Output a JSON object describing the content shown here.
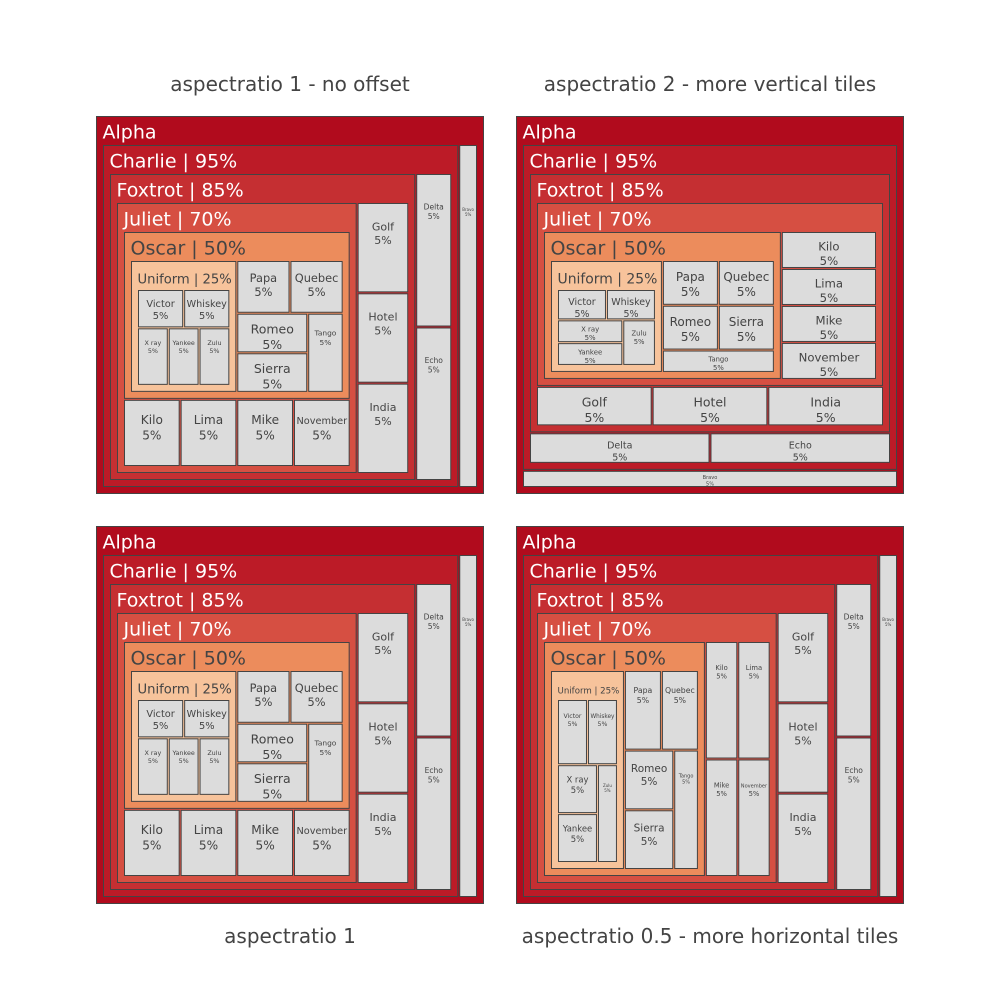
{
  "colors": {
    "Alpha": "#b10b1d",
    "Charlie": "#bc1b27",
    "Foxtrot": "#c52f32",
    "Juliet": "#d64f42",
    "Oscar": "#ec8c5c",
    "Uniform": "#f7c39b",
    "leaf": "#dcdcdc",
    "stroke": "#444444",
    "darkText": "#444444",
    "lightText": "#ffffff"
  },
  "panels": [
    {
      "title": "aspectratio 1 - no offset"
    },
    {
      "title": "aspectratio 2 - more vertical tiles"
    },
    {
      "title": "aspectratio 1"
    },
    {
      "title": "aspectratio 0.5 - more horizontal tiles"
    }
  ],
  "chart_data": [
    {
      "type": "treemap",
      "title": "aspectratio 1 - no offset",
      "nodes": [
        {
          "id": "Alpha",
          "label": "Alpha",
          "parent": "",
          "value": 100
        },
        {
          "id": "Bravo",
          "label": "Bravo",
          "parent": "Alpha",
          "value": 5,
          "text": "5%"
        },
        {
          "id": "Charlie",
          "label": "Charlie",
          "parent": "Alpha",
          "value": 95,
          "text": "95%"
        },
        {
          "id": "Delta",
          "label": "Delta",
          "parent": "Charlie",
          "value": 5,
          "text": "5%"
        },
        {
          "id": "Echo",
          "label": "Echo",
          "parent": "Charlie",
          "value": 5,
          "text": "5%"
        },
        {
          "id": "Foxtrot",
          "label": "Foxtrot",
          "parent": "Charlie",
          "value": 85,
          "text": "85%"
        },
        {
          "id": "Golf",
          "label": "Golf",
          "parent": "Foxtrot",
          "value": 5,
          "text": "5%"
        },
        {
          "id": "Hotel",
          "label": "Hotel",
          "parent": "Foxtrot",
          "value": 5,
          "text": "5%"
        },
        {
          "id": "India",
          "label": "India",
          "parent": "Foxtrot",
          "value": 5,
          "text": "5%"
        },
        {
          "id": "Juliet",
          "label": "Juliet",
          "parent": "Foxtrot",
          "value": 70,
          "text": "70%"
        },
        {
          "id": "Kilo",
          "label": "Kilo",
          "parent": "Juliet",
          "value": 5,
          "text": "5%"
        },
        {
          "id": "Lima",
          "label": "Lima",
          "parent": "Juliet",
          "value": 5,
          "text": "5%"
        },
        {
          "id": "Mike",
          "label": "Mike",
          "parent": "Juliet",
          "value": 5,
          "text": "5%"
        },
        {
          "id": "November",
          "label": "November",
          "parent": "Juliet",
          "value": 5,
          "text": "5%"
        },
        {
          "id": "Oscar",
          "label": "Oscar",
          "parent": "Juliet",
          "value": 50,
          "text": "50%"
        },
        {
          "id": "Papa",
          "label": "Papa",
          "parent": "Oscar",
          "value": 5,
          "text": "5%"
        },
        {
          "id": "Quebec",
          "label": "Quebec",
          "parent": "Oscar",
          "value": 5,
          "text": "5%"
        },
        {
          "id": "Romeo",
          "label": "Romeo",
          "parent": "Oscar",
          "value": 5,
          "text": "5%"
        },
        {
          "id": "Sierra",
          "label": "Sierra",
          "parent": "Oscar",
          "value": 5,
          "text": "5%"
        },
        {
          "id": "Tango",
          "label": "Tango",
          "parent": "Oscar",
          "value": 5,
          "text": "5%"
        },
        {
          "id": "Uniform",
          "label": "Uniform",
          "parent": "Oscar",
          "value": 25,
          "text": "25%"
        },
        {
          "id": "Victor",
          "label": "Victor",
          "parent": "Uniform",
          "value": 5,
          "text": "5%"
        },
        {
          "id": "Whiskey",
          "label": "Whiskey",
          "parent": "Uniform",
          "value": 5,
          "text": "5%"
        },
        {
          "id": "X ray",
          "label": "X ray",
          "parent": "Uniform",
          "value": 5,
          "text": "5%"
        },
        {
          "id": "Yankee",
          "label": "Yankee",
          "parent": "Uniform",
          "value": 5,
          "text": "5%"
        },
        {
          "id": "Zulu",
          "label": "Zulu",
          "parent": "Uniform",
          "value": 5,
          "text": "5%"
        }
      ]
    },
    {
      "type": "treemap",
      "title": "aspectratio 2 - more vertical tiles",
      "nodes": [
        {
          "id": "Alpha",
          "label": "Alpha",
          "parent": "",
          "value": 100
        },
        {
          "id": "Bravo",
          "label": "Bravo",
          "parent": "Alpha",
          "value": 5,
          "text": "5%"
        },
        {
          "id": "Charlie",
          "label": "Charlie",
          "parent": "Alpha",
          "value": 95,
          "text": "95%"
        },
        {
          "id": "Delta",
          "label": "Delta",
          "parent": "Charlie",
          "value": 5,
          "text": "5%"
        },
        {
          "id": "Echo",
          "label": "Echo",
          "parent": "Charlie",
          "value": 5,
          "text": "5%"
        },
        {
          "id": "Foxtrot",
          "label": "Foxtrot",
          "parent": "Charlie",
          "value": 85,
          "text": "85%"
        },
        {
          "id": "Golf",
          "label": "Golf",
          "parent": "Foxtrot",
          "value": 5,
          "text": "5%"
        },
        {
          "id": "Hotel",
          "label": "Hotel",
          "parent": "Foxtrot",
          "value": 5,
          "text": "5%"
        },
        {
          "id": "India",
          "label": "India",
          "parent": "Foxtrot",
          "value": 5,
          "text": "5%"
        },
        {
          "id": "Juliet",
          "label": "Juliet",
          "parent": "Foxtrot",
          "value": 70,
          "text": "70%"
        },
        {
          "id": "Kilo",
          "label": "Kilo",
          "parent": "Juliet",
          "value": 5,
          "text": "5%"
        },
        {
          "id": "Lima",
          "label": "Lima",
          "parent": "Juliet",
          "value": 5,
          "text": "5%"
        },
        {
          "id": "Mike",
          "label": "Mike",
          "parent": "Juliet",
          "value": 5,
          "text": "5%"
        },
        {
          "id": "November",
          "label": "November",
          "parent": "Juliet",
          "value": 5,
          "text": "5%"
        },
        {
          "id": "Oscar",
          "label": "Oscar",
          "parent": "Juliet",
          "value": 50,
          "text": "50%"
        },
        {
          "id": "Papa",
          "label": "Papa",
          "parent": "Oscar",
          "value": 5,
          "text": "5%"
        },
        {
          "id": "Quebec",
          "label": "Quebec",
          "parent": "Oscar",
          "value": 5,
          "text": "5%"
        },
        {
          "id": "Romeo",
          "label": "Romeo",
          "parent": "Oscar",
          "value": 5,
          "text": "5%"
        },
        {
          "id": "Sierra",
          "label": "Sierra",
          "parent": "Oscar",
          "value": 5,
          "text": "5%"
        },
        {
          "id": "Tango",
          "label": "Tango",
          "parent": "Oscar",
          "value": 5,
          "text": "5%"
        },
        {
          "id": "Uniform",
          "label": "Uniform",
          "parent": "Oscar",
          "value": 25,
          "text": "25%"
        },
        {
          "id": "Victor",
          "label": "Victor",
          "parent": "Uniform",
          "value": 5,
          "text": "5%"
        },
        {
          "id": "Whiskey",
          "label": "Whiskey",
          "parent": "Uniform",
          "value": 5,
          "text": "5%"
        },
        {
          "id": "X ray",
          "label": "X ray",
          "parent": "Uniform",
          "value": 5,
          "text": "5%"
        },
        {
          "id": "Yankee",
          "label": "Yankee",
          "parent": "Uniform",
          "value": 5,
          "text": "5%"
        },
        {
          "id": "Zulu",
          "label": "Zulu",
          "parent": "Uniform",
          "value": 5,
          "text": "5%"
        }
      ]
    },
    {
      "type": "treemap",
      "title": "aspectratio 1",
      "nodes": [
        {
          "id": "Alpha",
          "label": "Alpha",
          "parent": "",
          "value": 100
        },
        {
          "id": "Bravo",
          "label": "Bravo",
          "parent": "Alpha",
          "value": 5,
          "text": "5%"
        },
        {
          "id": "Charlie",
          "label": "Charlie",
          "parent": "Alpha",
          "value": 95,
          "text": "95%"
        },
        {
          "id": "Delta",
          "label": "Delta",
          "parent": "Charlie",
          "value": 5,
          "text": "5%"
        },
        {
          "id": "Echo",
          "label": "Echo",
          "parent": "Charlie",
          "value": 5,
          "text": "5%"
        },
        {
          "id": "Foxtrot",
          "label": "Foxtrot",
          "parent": "Charlie",
          "value": 85,
          "text": "85%"
        },
        {
          "id": "Golf",
          "label": "Golf",
          "parent": "Foxtrot",
          "value": 5,
          "text": "5%"
        },
        {
          "id": "Hotel",
          "label": "Hotel",
          "parent": "Foxtrot",
          "value": 5,
          "text": "5%"
        },
        {
          "id": "India",
          "label": "India",
          "parent": "Foxtrot",
          "value": 5,
          "text": "5%"
        },
        {
          "id": "Juliet",
          "label": "Juliet",
          "parent": "Foxtrot",
          "value": 70,
          "text": "70%"
        },
        {
          "id": "Kilo",
          "label": "Kilo",
          "parent": "Juliet",
          "value": 5,
          "text": "5%"
        },
        {
          "id": "Lima",
          "label": "Lima",
          "parent": "Juliet",
          "value": 5,
          "text": "5%"
        },
        {
          "id": "Mike",
          "label": "Mike",
          "parent": "Juliet",
          "value": 5,
          "text": "5%"
        },
        {
          "id": "November",
          "label": "November",
          "parent": "Juliet",
          "value": 5,
          "text": "5%"
        },
        {
          "id": "Oscar",
          "label": "Oscar",
          "parent": "Juliet",
          "value": 50,
          "text": "50%"
        },
        {
          "id": "Papa",
          "label": "Papa",
          "parent": "Oscar",
          "value": 5,
          "text": "5%"
        },
        {
          "id": "Quebec",
          "label": "Quebec",
          "parent": "Oscar",
          "value": 5,
          "text": "5%"
        },
        {
          "id": "Romeo",
          "label": "Romeo",
          "parent": "Oscar",
          "value": 5,
          "text": "5%"
        },
        {
          "id": "Sierra",
          "label": "Sierra",
          "parent": "Oscar",
          "value": 5,
          "text": "5%"
        },
        {
          "id": "Tango",
          "label": "Tango",
          "parent": "Oscar",
          "value": 5,
          "text": "5%"
        },
        {
          "id": "Uniform",
          "label": "Uniform",
          "parent": "Oscar",
          "value": 25,
          "text": "25%"
        },
        {
          "id": "Victor",
          "label": "Victor",
          "parent": "Uniform",
          "value": 5,
          "text": "5%"
        },
        {
          "id": "Whiskey",
          "label": "Whiskey",
          "parent": "Uniform",
          "value": 5,
          "text": "5%"
        },
        {
          "id": "X ray",
          "label": "X ray",
          "parent": "Uniform",
          "value": 5,
          "text": "5%"
        },
        {
          "id": "Yankee",
          "label": "Yankee",
          "parent": "Uniform",
          "value": 5,
          "text": "5%"
        },
        {
          "id": "Zulu",
          "label": "Zulu",
          "parent": "Uniform",
          "value": 5,
          "text": "5%"
        }
      ]
    },
    {
      "type": "treemap",
      "title": "aspectratio 0.5 - more horizontal tiles",
      "nodes": [
        {
          "id": "Alpha",
          "label": "Alpha",
          "parent": "",
          "value": 100
        },
        {
          "id": "Bravo",
          "label": "Bravo",
          "parent": "Alpha",
          "value": 5,
          "text": "5%"
        },
        {
          "id": "Charlie",
          "label": "Charlie",
          "parent": "Alpha",
          "value": 95,
          "text": "95%"
        },
        {
          "id": "Delta",
          "label": "Delta",
          "parent": "Charlie",
          "value": 5,
          "text": "5%"
        },
        {
          "id": "Echo",
          "label": "Echo",
          "parent": "Charlie",
          "value": 5,
          "text": "5%"
        },
        {
          "id": "Foxtrot",
          "label": "Foxtrot",
          "parent": "Charlie",
          "value": 85,
          "text": "85%"
        },
        {
          "id": "Golf",
          "label": "Golf",
          "parent": "Foxtrot",
          "value": 5,
          "text": "5%"
        },
        {
          "id": "Hotel",
          "label": "Hotel",
          "parent": "Foxtrot",
          "value": 5,
          "text": "5%"
        },
        {
          "id": "India",
          "label": "India",
          "parent": "Foxtrot",
          "value": 5,
          "text": "5%"
        },
        {
          "id": "Juliet",
          "label": "Juliet",
          "parent": "Foxtrot",
          "value": 70,
          "text": "70%"
        },
        {
          "id": "Kilo",
          "label": "Kilo",
          "parent": "Juliet",
          "value": 5,
          "text": "5%"
        },
        {
          "id": "Lima",
          "label": "Lima",
          "parent": "Juliet",
          "value": 5,
          "text": "5%"
        },
        {
          "id": "Mike",
          "label": "Mike",
          "parent": "Juliet",
          "value": 5,
          "text": "5%"
        },
        {
          "id": "November",
          "label": "November",
          "parent": "Juliet",
          "value": 5,
          "text": "5%"
        },
        {
          "id": "Oscar",
          "label": "Oscar",
          "parent": "Juliet",
          "value": 50,
          "text": "50%"
        },
        {
          "id": "Papa",
          "label": "Papa",
          "parent": "Oscar",
          "value": 5,
          "text": "5%"
        },
        {
          "id": "Quebec",
          "label": "Quebec",
          "parent": "Oscar",
          "value": 5,
          "text": "5%"
        },
        {
          "id": "Romeo",
          "label": "Romeo",
          "parent": "Oscar",
          "value": 5,
          "text": "5%"
        },
        {
          "id": "Sierra",
          "label": "Sierra",
          "parent": "Oscar",
          "value": 5,
          "text": "5%"
        },
        {
          "id": "Tango",
          "label": "Tango",
          "parent": "Oscar",
          "value": 5,
          "text": "5%"
        },
        {
          "id": "Uniform",
          "label": "Uniform",
          "parent": "Oscar",
          "value": 25,
          "text": "25%"
        },
        {
          "id": "Victor",
          "label": "Victor",
          "parent": "Uniform",
          "value": 5,
          "text": "5%"
        },
        {
          "id": "Whiskey",
          "label": "Whiskey",
          "parent": "Uniform",
          "value": 5,
          "text": "5%"
        },
        {
          "id": "X ray",
          "label": "X ray",
          "parent": "Uniform",
          "value": 5,
          "text": "5%"
        },
        {
          "id": "Yankee",
          "label": "Yankee",
          "parent": "Uniform",
          "value": 5,
          "text": "5%"
        },
        {
          "id": "Zulu",
          "label": "Zulu",
          "parent": "Uniform",
          "value": 5,
          "text": "5%"
        }
      ]
    }
  ]
}
